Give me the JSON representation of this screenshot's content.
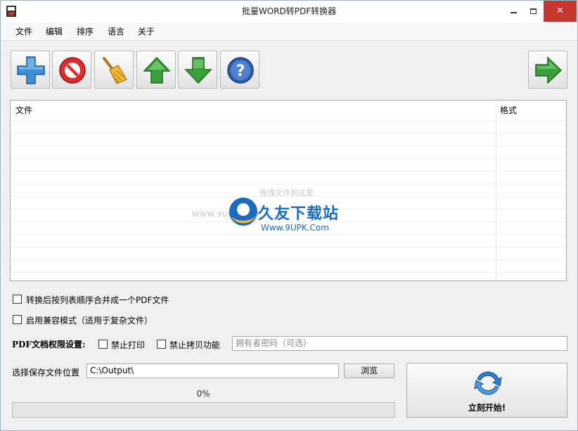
{
  "window": {
    "title": "批量WORD转PDF转换器",
    "close_glyph": "✕"
  },
  "menu": [
    {
      "label": "文件"
    },
    {
      "label": "编辑"
    },
    {
      "label": "排序"
    },
    {
      "label": "语言"
    },
    {
      "label": "关于"
    }
  ],
  "toolbar": {
    "buttons": [
      "add-icon",
      "remove-icon",
      "clear-broom-icon",
      "move-up-icon",
      "move-down-icon",
      "help-icon"
    ],
    "next_button": "next-arrow-icon"
  },
  "file_list": {
    "columns": [
      "文件",
      "格式"
    ],
    "rows": [],
    "drop_hint": "拖拽文件到这里"
  },
  "watermark": {
    "url": "WWW.9UPK.COM",
    "title": "久友下载站",
    "subtitle": "Www.9UPK.Com"
  },
  "options": {
    "merge_label": "转换后按列表顺序合并成一个PDF文件",
    "merge_checked": false,
    "compat_label": "启用兼容模式（适用于复杂文件）",
    "compat_checked": false
  },
  "permissions": {
    "title": "PDF文档权限设置:",
    "no_print_label": "禁止打印",
    "no_print_checked": false,
    "no_copy_label": "禁止拷贝功能",
    "no_copy_checked": false,
    "owner_password_placeholder": "拥有者密码（可选）"
  },
  "output": {
    "label": "选择保存文件位置",
    "path": "C:\\Output\\",
    "browse_label": "浏览"
  },
  "progress": {
    "percent_text": "0%",
    "value": 0
  },
  "start": {
    "label": "立刻开始!"
  },
  "colors": {
    "close_red": "#c7362f",
    "plus_blue": "#3d8fd6",
    "arrow_green": "#3aa13a",
    "watermark_blue": "#1a6bc4"
  }
}
